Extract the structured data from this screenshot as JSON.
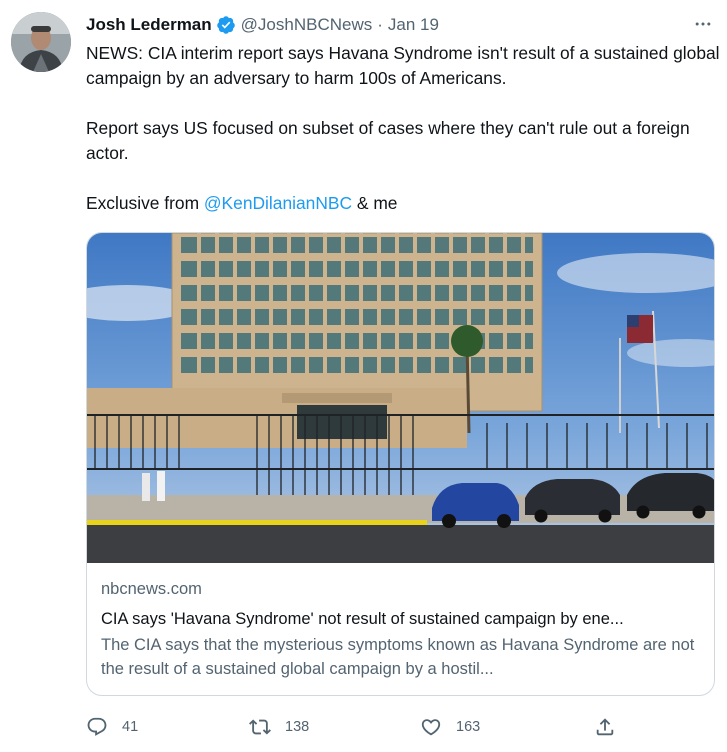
{
  "tweet": {
    "author_name": "Josh Lederman",
    "handle": "@JoshNBCNews",
    "separator": "·",
    "timestamp": "Jan 19",
    "text_p1": "NEWS: CIA interim report says Havana Syndrome isn't result of a sustained global campaign by an adversary to harm 100s of Americans.",
    "text_p2": "Report says US focused on subset of cases where they can't rule out a foreign actor.",
    "text_p3_prefix": "Exclusive from ",
    "mention": "@KenDilanianNBC",
    "text_p3_suffix": " & me"
  },
  "card": {
    "image_alt": "",
    "domain": "nbcnews.com",
    "title": "CIA says 'Havana Syndrome' not result of sustained campaign by ene...",
    "description": "The CIA says that the mysterious symptoms known as Havana Syndrome are not the result of a sustained global campaign by a hostil..."
  },
  "actions": {
    "reply_count": "41",
    "retweet_count": "138",
    "like_count": "163"
  },
  "colors": {
    "accent": "#1d9bf0",
    "secondary_text": "#536471",
    "border": "#cfd9de"
  },
  "icons": [
    "verified-badge-icon",
    "more-icon",
    "reply-icon",
    "retweet-icon",
    "like-icon",
    "share-icon"
  ]
}
